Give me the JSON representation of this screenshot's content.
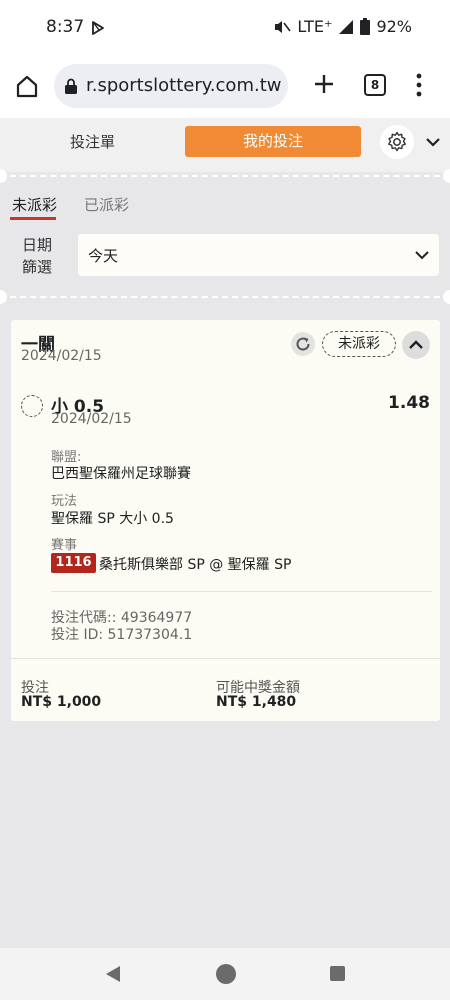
{
  "status_bar": {
    "time": "8:37",
    "network": "LTE⁺",
    "battery": "92%"
  },
  "browser": {
    "url": "r.sportslottery.com.tw",
    "tab_count": "8"
  },
  "header": {
    "betslip_tab": "投注單",
    "mybets_tab": "我的投注",
    "accent_color": "#f08a34"
  },
  "subtabs": {
    "unsettled": "未派彩",
    "settled": "已派彩"
  },
  "filter": {
    "label": "日期篩選",
    "value": "今天"
  },
  "bet": {
    "type": "一關",
    "date": "2024/02/15",
    "status": "未派彩",
    "selection": {
      "name": "小 0.5",
      "date": "2024/02/15",
      "odds": "1.48"
    },
    "league_label": "聯盟:",
    "league": "巴西聖保羅州足球聯賽",
    "market_label": "玩法",
    "market": "聖保羅 SP 大小 0.5",
    "event_label": "賽事",
    "event_id": "1116",
    "event_name": "桑托斯俱樂部 SP @ 聖保羅 SP",
    "bet_code": "投注代碼:: 49364977",
    "bet_id": "投注 ID: 51737304.1",
    "stake_label": "投注",
    "stake": "NT$ 1,000",
    "payout_label": "可能中獎金額",
    "payout": "NT$ 1,480"
  }
}
